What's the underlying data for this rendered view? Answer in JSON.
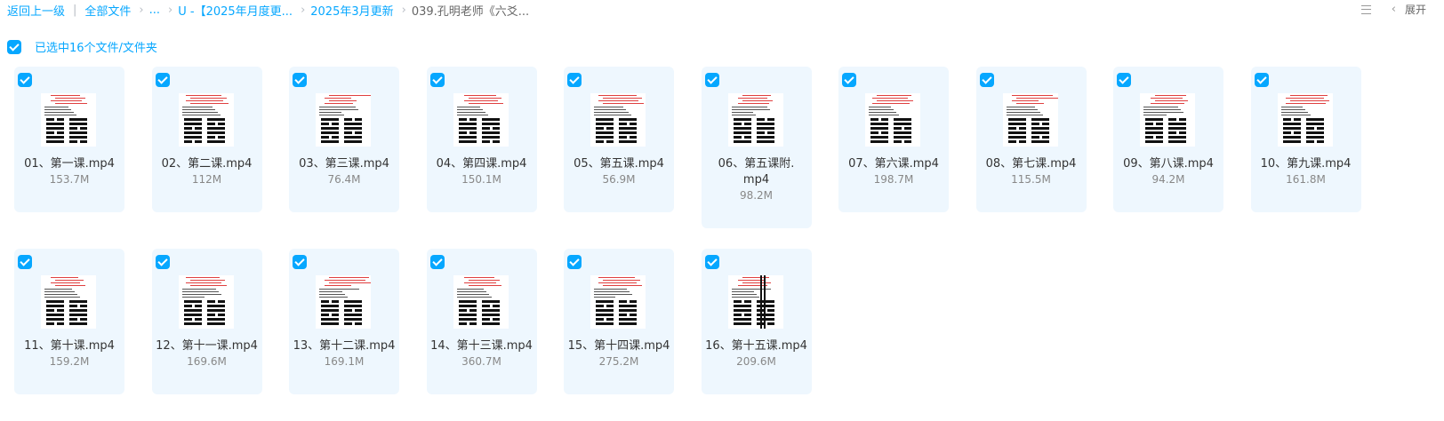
{
  "breadcrumb": {
    "back": "返回上一级",
    "all_files": "全部文件",
    "ellipsis": "...",
    "folder1": "U -【2025年月度更...",
    "folder2": "2025年3月更新",
    "current": "039.孔明老师《六爻..."
  },
  "toolbar": {
    "expand": "展开"
  },
  "selection": {
    "text": "已选中16个文件/文件夹"
  },
  "files": [
    {
      "name": "01、第一课.mp4",
      "size": "153.7M"
    },
    {
      "name": "02、第二课.mp4",
      "size": "112M"
    },
    {
      "name": "03、第三课.mp4",
      "size": "76.4M"
    },
    {
      "name": "04、第四课.mp4",
      "size": "150.1M"
    },
    {
      "name": "05、第五课.mp4",
      "size": "56.9M"
    },
    {
      "name": "06、第五课附.mp4",
      "size": "98.2M"
    },
    {
      "name": "07、第六课.mp4",
      "size": "198.7M"
    },
    {
      "name": "08、第七课.mp4",
      "size": "115.5M"
    },
    {
      "name": "09、第八课.mp4",
      "size": "94.2M"
    },
    {
      "name": "10、第九课.mp4",
      "size": "161.8M"
    },
    {
      "name": "11、第十课.mp4",
      "size": "159.2M"
    },
    {
      "name": "12、第十一课.mp4",
      "size": "169.6M"
    },
    {
      "name": "13、第十二课.mp4",
      "size": "169.1M"
    },
    {
      "name": "14、第十三课.mp4",
      "size": "360.7M"
    },
    {
      "name": "15、第十四课.mp4",
      "size": "275.2M"
    },
    {
      "name": "16、第十五课.mp4",
      "size": "209.6M"
    }
  ]
}
